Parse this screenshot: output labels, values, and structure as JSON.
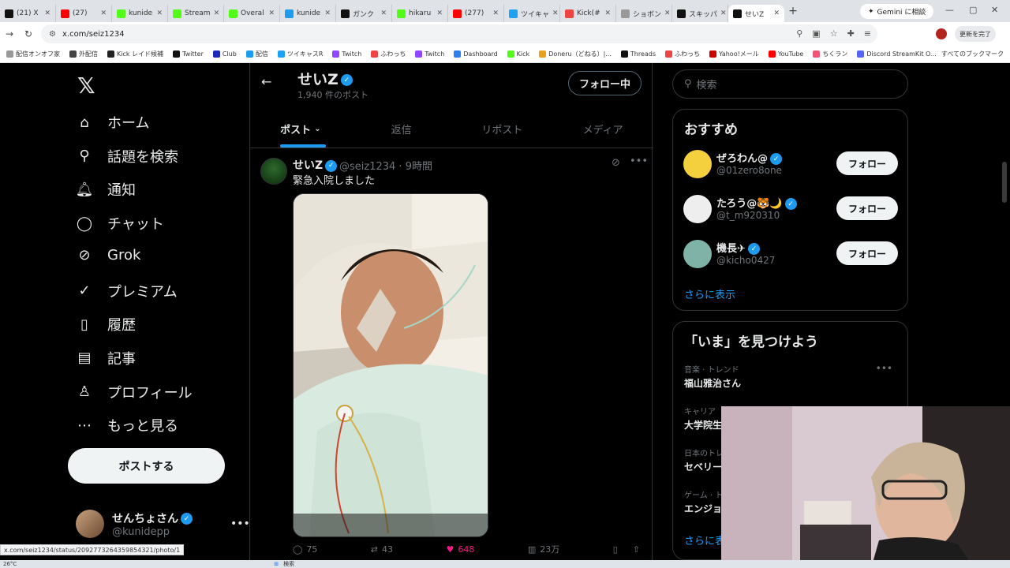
{
  "browser": {
    "tabs": [
      {
        "label": "(21) X",
        "color": "#111111"
      },
      {
        "label": "(27)",
        "color": "#ff0000"
      },
      {
        "label": "kunide",
        "color": "#53fc18"
      },
      {
        "label": "Stream",
        "color": "#53fc18"
      },
      {
        "label": "Overal",
        "color": "#53fc18"
      },
      {
        "label": "kunide",
        "color": "#1d9bf0"
      },
      {
        "label": "ガンク",
        "color": "#111111"
      },
      {
        "label": "hikaru",
        "color": "#53fc18"
      },
      {
        "label": "(277)",
        "color": "#ff0000"
      },
      {
        "label": "ツイキャ",
        "color": "#1da1f2"
      },
      {
        "label": "Kick(#",
        "color": "#e44"
      },
      {
        "label": "ショボン",
        "color": "#999999"
      },
      {
        "label": "スキッパ",
        "color": "#111111"
      },
      {
        "label": "せいZ",
        "color": "#111111"
      }
    ],
    "gemini_button": "Gemini に相談",
    "url": "x.com/seiz1234",
    "update_button": "更新を完了",
    "bookmarks": [
      "配信オンオフ家",
      "外配信",
      "Kick レイド候補",
      "Twitter",
      "Club",
      "配信",
      "ツイキャスR",
      "Twitch",
      "ふわっち",
      "Twitch",
      "Dashboard",
      "Kick",
      "Doneru（どねる）|...",
      "Threads",
      "ふわっち",
      "Yahoo!メール",
      "YouTube",
      "ちくラン",
      "Discord StreamKit O..."
    ],
    "bookmarks_all": "すべてのブックマーク",
    "status_url": "x.com/seiz1234/status/2092773264359854321/photo/1"
  },
  "nav": {
    "items": [
      {
        "label": "ホーム",
        "icon": "home-icon",
        "glyph": "⌂"
      },
      {
        "label": "話題を検索",
        "icon": "search-icon",
        "glyph": "⚲"
      },
      {
        "label": "通知",
        "icon": "bell-icon",
        "glyph": "🔔︎"
      },
      {
        "label": "チャット",
        "icon": "chat-icon",
        "glyph": "◯"
      },
      {
        "label": "Grok",
        "icon": "grok-icon",
        "glyph": "⊘"
      },
      {
        "label": "プレミアム",
        "icon": "premium-icon",
        "glyph": "✓"
      },
      {
        "label": "履歴",
        "icon": "bookmark-icon",
        "glyph": "▯"
      },
      {
        "label": "記事",
        "icon": "article-icon",
        "glyph": "▤"
      },
      {
        "label": "プロフィール",
        "icon": "person-icon",
        "glyph": "♙"
      },
      {
        "label": "もっと見る",
        "icon": "more-circle-icon",
        "glyph": "⋯"
      }
    ],
    "post_button": "ポストする",
    "me": {
      "name": "せんちょさん",
      "handle": "@kunidepp"
    }
  },
  "profile": {
    "name": "せいZ",
    "post_count": "1,940 件のポスト",
    "following_button": "フォロー中",
    "tabs": [
      "ポスト",
      "返信",
      "リポスト",
      "メディア"
    ]
  },
  "tweet": {
    "name": "せいZ",
    "meta": "@seiz1234 · 9時間",
    "text": "緊急入院しました",
    "stats": {
      "replies": "75",
      "reposts": "43",
      "likes": "648",
      "views": "23万"
    }
  },
  "right": {
    "search_placeholder": "検索",
    "suggest_title": "おすすめ",
    "suggestions": [
      {
        "name": "ぜろわん@",
        "handle": "@01zero8one",
        "follow": "フォロー",
        "color": "#f4d03f"
      },
      {
        "name": "たろう@🐯🌙",
        "handle": "@t_m920310",
        "follow": "フォロー",
        "color": "#eeeeee"
      },
      {
        "name": "機長✈",
        "handle": "@kicho0427",
        "follow": "フォロー",
        "color": "#7fb3a8"
      }
    ],
    "show_more": "さらに表示",
    "trends_title": "「いま」を見つけよう",
    "trends": [
      {
        "category": "音楽 · トレンド",
        "name": "福山雅治さん"
      },
      {
        "category": "キャリア",
        "name": "大学院生"
      },
      {
        "category": "日本のトレ",
        "name": "セベリー"
      },
      {
        "category": "ゲーム · ト",
        "name": "エンジョ"
      }
    ],
    "trends_more": "さらに表"
  },
  "taskbar": {
    "weather": "26°C",
    "search": "検索"
  }
}
